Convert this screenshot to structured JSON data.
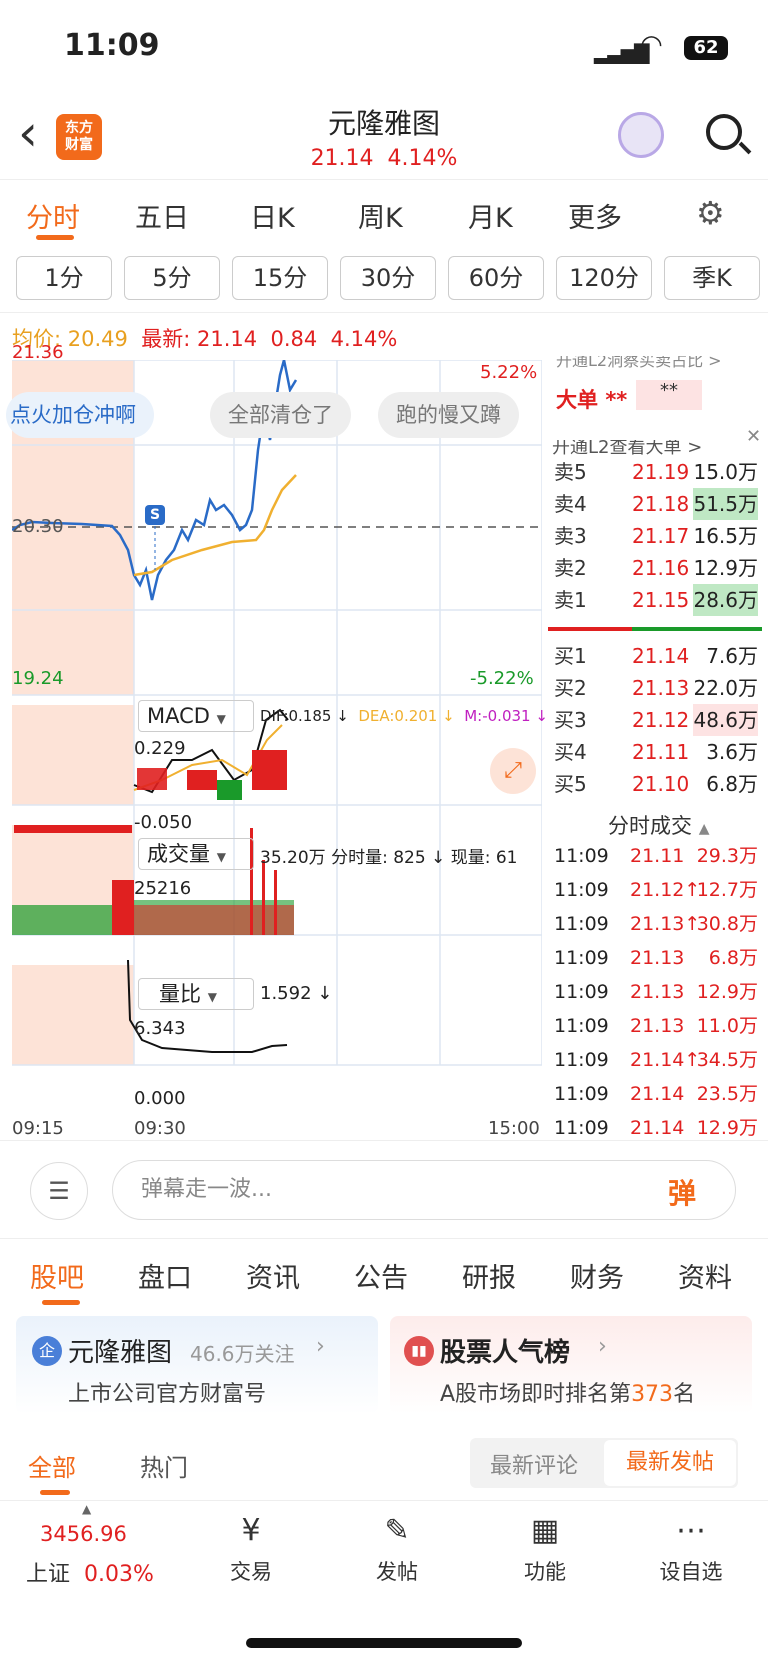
{
  "status": {
    "time": "11:09",
    "battery": "62"
  },
  "header": {
    "back": "‹",
    "logo": "东方\n财富",
    "title": "元隆雅图",
    "price": "21.14",
    "change_pct": "4.14%"
  },
  "chart_tabs": [
    "分时",
    "五日",
    "日K",
    "周K",
    "月K",
    "更多"
  ],
  "intervals": [
    "1分",
    "5分",
    "15分",
    "30分",
    "60分",
    "120分",
    "季K"
  ],
  "price_line": {
    "avg_label": "均价:",
    "avg": "20.49",
    "last_label": "最新:",
    "last": "21.14",
    "chg": "0.84",
    "pct": "4.14%"
  },
  "chart_labels": {
    "high": "21.36",
    "mid": "20.30",
    "low": "19.24",
    "up_pct": "5.22%",
    "down_pct": "-5.22%",
    "s_marker": "S"
  },
  "danmaku": [
    "点火加仓冲啊",
    "全部清仓了",
    "跑的慢又蹲"
  ],
  "macd": {
    "name": "MACD",
    "dif": "DIF:0.185 ↓",
    "dea": "DEA:0.201 ↓",
    "m": "M:-0.031 ↓",
    "top": "0.229",
    "bottom": "-0.050"
  },
  "volume": {
    "name": "成交量",
    "total": "35.20万",
    "fs": "分时量: 825 ↓",
    "now": "现量: 61",
    "top": "25216"
  },
  "ratio": {
    "name": "量比",
    "val": "1.592 ↓",
    "top": "6.343",
    "bottom": "0.000"
  },
  "time_axis": [
    "09:15",
    "09:30",
    "15:00"
  ],
  "l2": {
    "banner": "开通L2洞察买卖占比 >",
    "big_label": "大单",
    "big_stars1": "**",
    "big_stars2": "**",
    "banner2": "开通L2查看大单 >"
  },
  "asks": [
    {
      "l": "卖5",
      "p": "21.19",
      "v": "15.0万"
    },
    {
      "l": "卖4",
      "p": "21.18",
      "v": "51.5万"
    },
    {
      "l": "卖3",
      "p": "21.17",
      "v": "16.5万"
    },
    {
      "l": "卖2",
      "p": "21.16",
      "v": "12.9万"
    },
    {
      "l": "卖1",
      "p": "21.15",
      "v": "28.6万"
    }
  ],
  "bids": [
    {
      "l": "买1",
      "p": "21.14",
      "v": "7.6万"
    },
    {
      "l": "买2",
      "p": "21.13",
      "v": "22.0万"
    },
    {
      "l": "买3",
      "p": "21.12",
      "v": "48.6万"
    },
    {
      "l": "买4",
      "p": "21.11",
      "v": "3.6万"
    },
    {
      "l": "买5",
      "p": "21.10",
      "v": "6.8万"
    }
  ],
  "trades_title": "分时成交",
  "trades": [
    {
      "t": "11:09",
      "p": "21.11",
      "v": "29.3万"
    },
    {
      "t": "11:09",
      "p": "21.12↑",
      "v": "12.7万"
    },
    {
      "t": "11:09",
      "p": "21.13↑",
      "v": "30.8万"
    },
    {
      "t": "11:09",
      "p": "21.13",
      "v": "6.8万"
    },
    {
      "t": "11:09",
      "p": "21.13",
      "v": "12.9万"
    },
    {
      "t": "11:09",
      "p": "21.13",
      "v": "11.0万"
    },
    {
      "t": "11:09",
      "p": "21.14↑",
      "v": "34.5万"
    },
    {
      "t": "11:09",
      "p": "21.14",
      "v": "23.5万"
    },
    {
      "t": "11:09",
      "p": "21.14",
      "v": "12.9万"
    }
  ],
  "danmu_input": {
    "placeholder": "弹幕走一波...",
    "btn": "弹"
  },
  "sections": [
    "股吧",
    "盘口",
    "资讯",
    "公告",
    "研报",
    "财务",
    "资料"
  ],
  "card1": {
    "badge": "企",
    "name": "元隆雅图",
    "followers": "46.6万关注",
    "desc": "上市公司官方财富号"
  },
  "card2": {
    "name": "股票人气榜",
    "desc_pre": "A股市场即时排名第",
    "rank": "373",
    "desc_post": "名"
  },
  "filters": {
    "all": "全部",
    "hot": "热门",
    "latest_comment": "最新评论",
    "latest_post": "最新发帖"
  },
  "bottom": {
    "index_val": "3456.96",
    "index_name": "上证",
    "index_pct": "0.03%",
    "items": [
      "交易",
      "发帖",
      "功能",
      "设自选"
    ]
  },
  "colors": {
    "accent": "#f26a1b",
    "up": "#e02020",
    "down": "#1a9a2a",
    "line": "#2a6bc7",
    "avg": "#f0b030"
  }
}
